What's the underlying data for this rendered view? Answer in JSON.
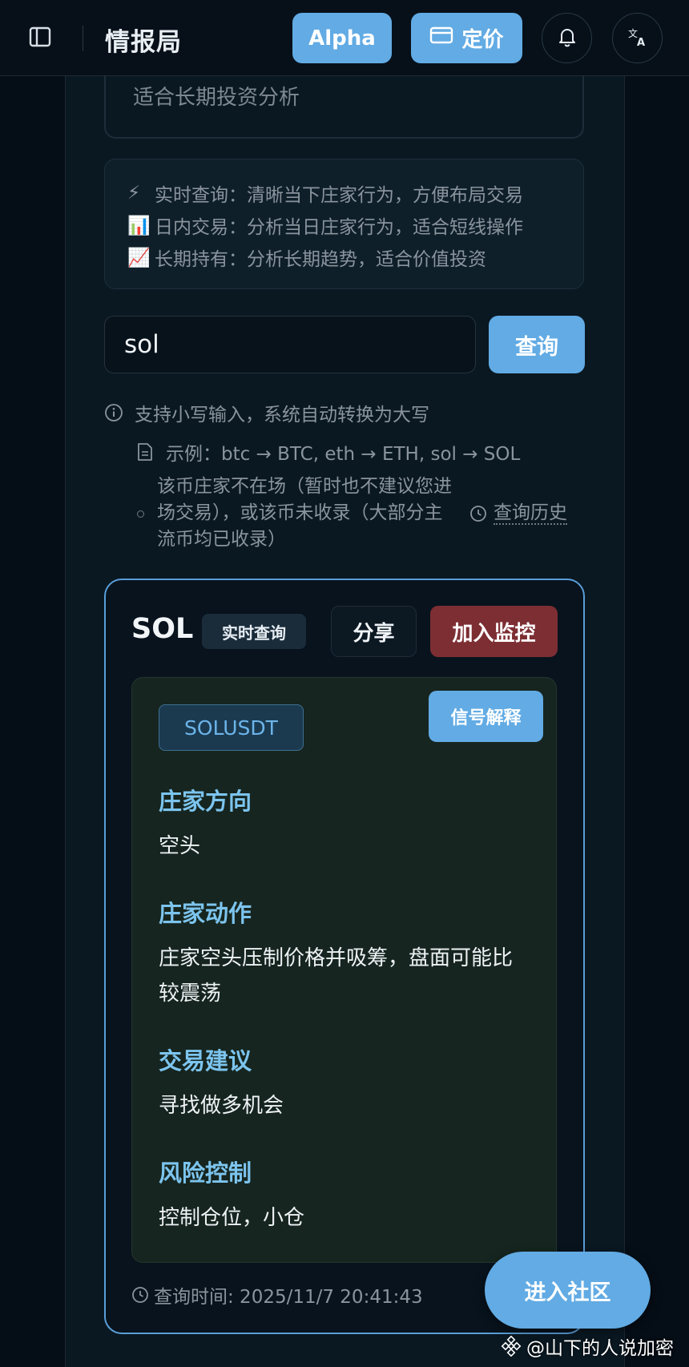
{
  "header": {
    "title": "情报局",
    "alpha_label": "Alpha",
    "pricing_label": "定价"
  },
  "intro": {
    "description": "适合长期投资分析",
    "modes": [
      {
        "emoji": "⚡",
        "text": "实时查询：清晰当下庄家行为，方便布局交易"
      },
      {
        "emoji": "📊",
        "text": "日内交易：分析当日庄家行为，适合短线操作"
      },
      {
        "emoji": "📈",
        "text": "长期持有：分析长期趋势，适合价值投资"
      }
    ]
  },
  "search": {
    "value": "sol",
    "button_label": "查询"
  },
  "hints": {
    "lowercase": "支持小写输入，系统自动转换为大写",
    "example": "示例：btc → BTC, eth → ETH, sol → SOL",
    "status": "该币庄家不在场（暂时也不建议您进场交易），或该币未收录（大部分主流币均已收录）",
    "history_label": "查询历史"
  },
  "result": {
    "symbol": "SOL",
    "mode_badge": "实时查询",
    "share_label": "分享",
    "monitor_label": "加入监控",
    "pair": "SOLUSDT",
    "explain_label": "信号解释",
    "sections": [
      {
        "title": "庄家方向",
        "body": "空头"
      },
      {
        "title": "庄家动作",
        "body": "庄家空头压制价格并吸筹，盘面可能比较震荡"
      },
      {
        "title": "交易建议",
        "body": "寻找做多机会"
      },
      {
        "title": "风险控制",
        "body": "控制仓位，小仓"
      }
    ],
    "query_time": "查询时间: 2025/11/7 20:41:43"
  },
  "community_label": "进入社区",
  "watermark": "@山下的人说加密",
  "colors": {
    "accent": "#62abe4",
    "danger": "#7d2e33",
    "section_title": "#7cc4ee",
    "background": "#050d16"
  }
}
